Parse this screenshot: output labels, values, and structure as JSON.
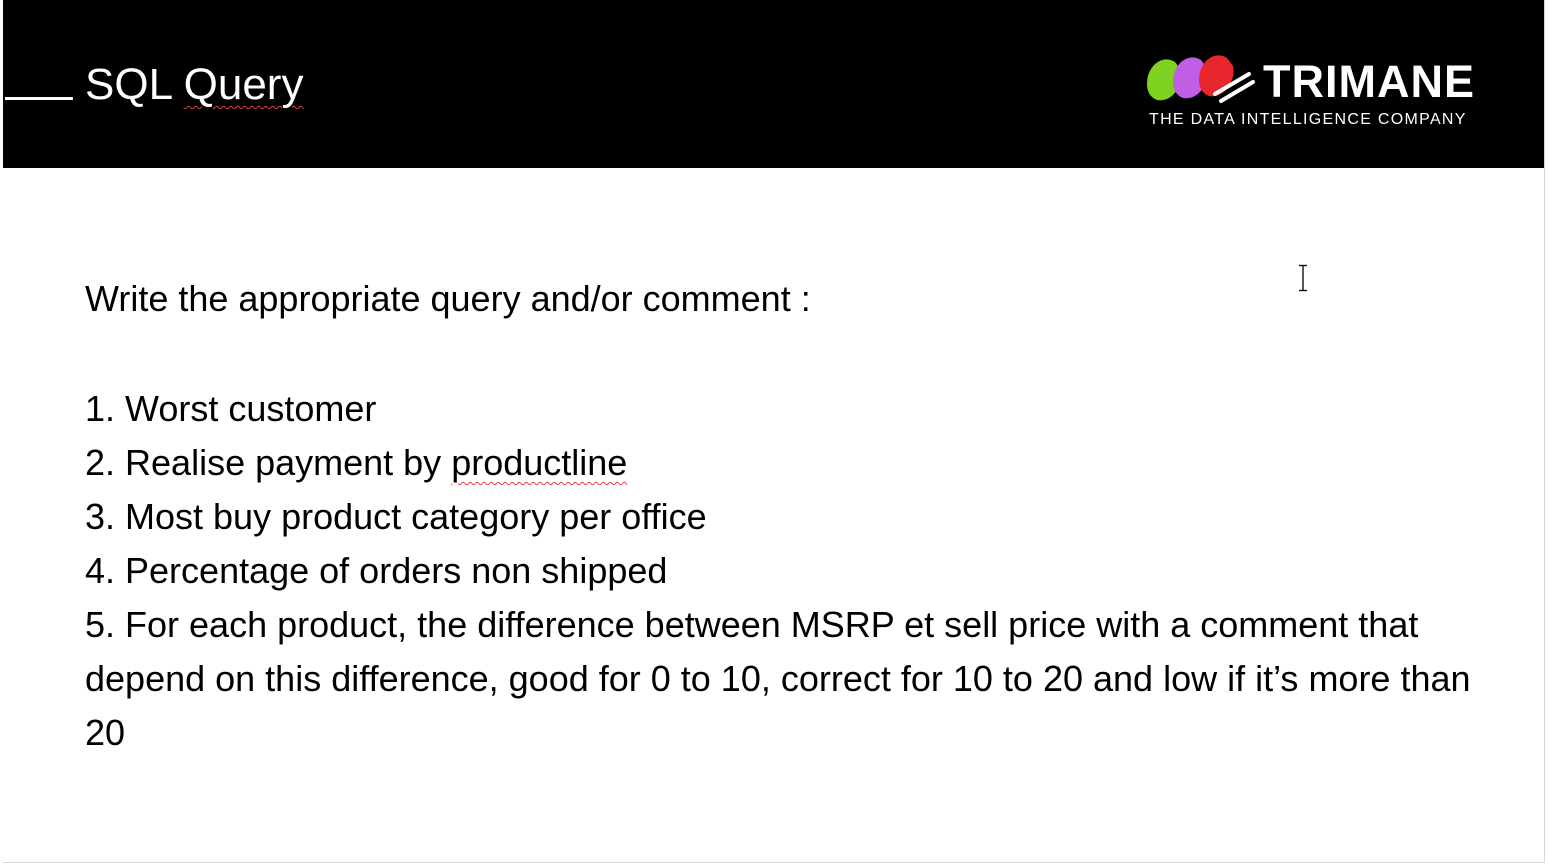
{
  "slide": {
    "title_plain": "SQL ",
    "title_squiggle": "Query",
    "logo": {
      "wordmark": "TRIMANE",
      "tagline": "THE DATA INTELLIGENCE COMPANY",
      "icon": "trimane-logo-icon",
      "colors": [
        "#7ed321",
        "#c15ee6",
        "#e8262d"
      ]
    },
    "intro": "Write the appropriate query and/or comment :",
    "tasks": [
      {
        "prefix": "1. Worst customer",
        "squiggle": "",
        "suffix": ""
      },
      {
        "prefix": "2. Realise payment by ",
        "squiggle": "productline",
        "suffix": ""
      },
      {
        "prefix": "3. Most buy product category per office",
        "squiggle": "",
        "suffix": ""
      },
      {
        "prefix": "4. Percentage of orders non shipped",
        "squiggle": "",
        "suffix": ""
      },
      {
        "prefix": "5. For each product, the difference between MSRP et sell price with a comment that depend on this difference, good for 0 to 10, correct for 10 to 20 and low if it’s more than 20",
        "squiggle": "",
        "suffix": ""
      }
    ]
  },
  "colors": {
    "header_background": "#000000",
    "header_text": "#ffffff",
    "body_text": "#000000",
    "spellcheck_underline": "#e04040"
  },
  "cursor": {
    "icon": "text-cursor-icon"
  }
}
